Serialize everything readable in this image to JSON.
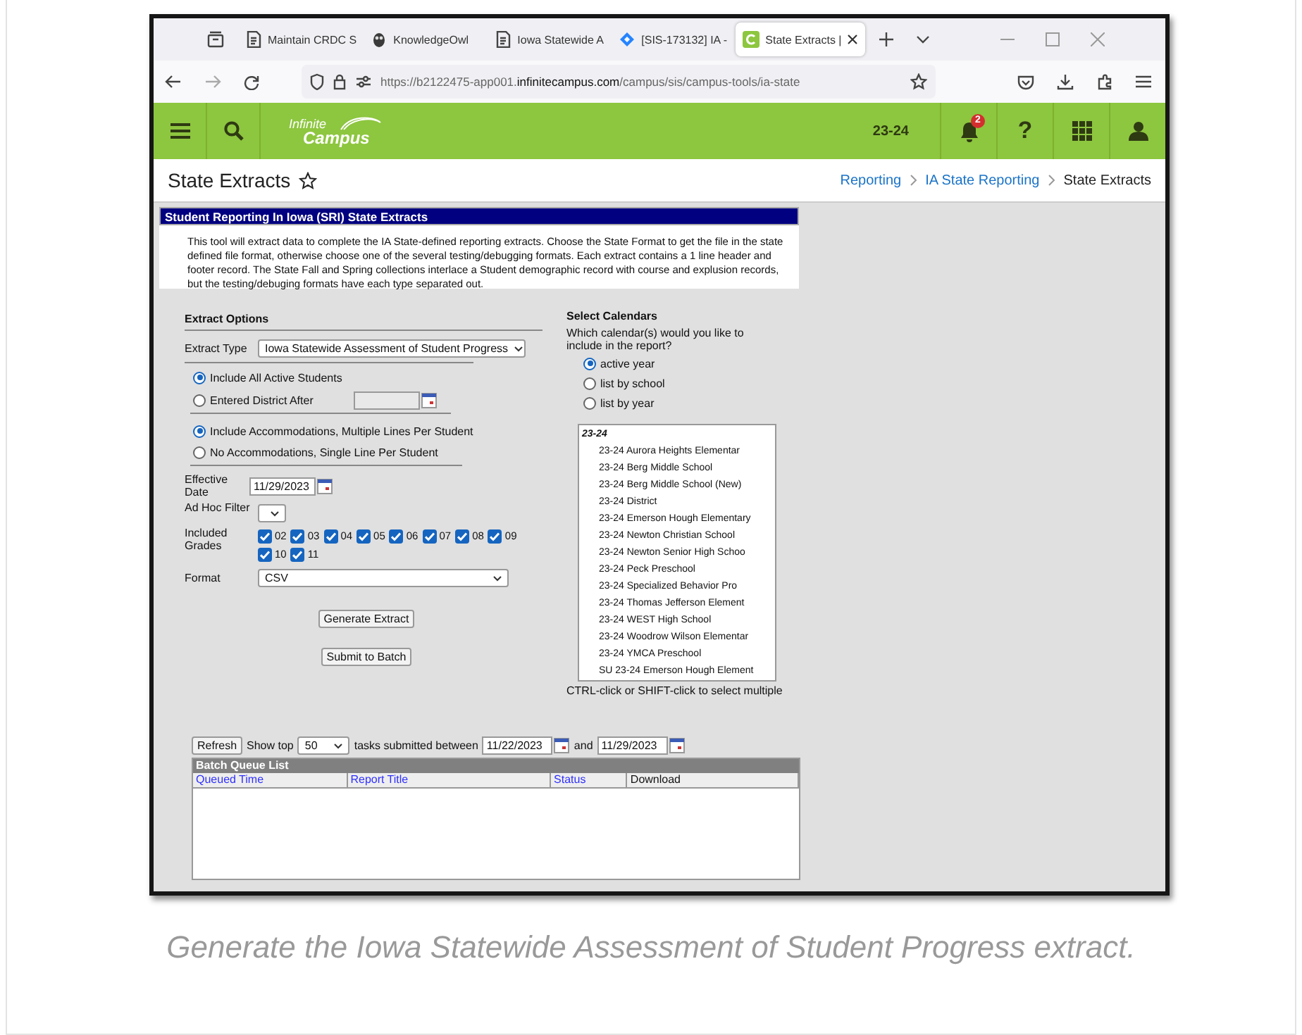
{
  "browser": {
    "tabs": [
      {
        "label": "Maintain CRDC S",
        "kind": "doc",
        "selected": false
      },
      {
        "label": "KnowledgeOwl",
        "kind": "owl",
        "selected": false
      },
      {
        "label": "Iowa Statewide A",
        "kind": "doc",
        "selected": false
      },
      {
        "label": "[SIS-173132] IA -",
        "kind": "jira",
        "selected": false
      },
      {
        "label": "State Extracts |",
        "kind": "app",
        "selected": true
      }
    ],
    "url": {
      "prefix": "https://b2122475-app001.",
      "domain": "infinitecampus.com",
      "path": "/campus/sis/campus-tools/ia-state"
    }
  },
  "app_header": {
    "logo": [
      "Infinite",
      "Campus"
    ],
    "school_year": "23-24",
    "notification_count": "2",
    "help": "?"
  },
  "page": {
    "title": "State Extracts",
    "breadcrumb": [
      "Reporting",
      "IA State Reporting",
      "State Extracts"
    ]
  },
  "panel": {
    "title": "Student Reporting In Iowa (SRI) State Extracts",
    "description": "This tool will extract data to complete the IA State-defined reporting extracts. Choose the State Format to get the file in the state defined file format, otherwise choose one of the several testing/debugging formats. Each extract contains a 1 line header and footer record. The State Fall and Spring collections interlace a Student demographic record with course and explusion records, but the testing/debuging formats have each type separated out."
  },
  "extract_options": {
    "heading": "Extract Options",
    "extract_type": {
      "label": "Extract Type",
      "value": "Iowa Statewide Assessment of Student Progress"
    },
    "student_options": [
      {
        "label": "Include All Active Students",
        "selected": true
      },
      {
        "label": "Entered District After",
        "selected": false
      }
    ],
    "accommodation_options": [
      {
        "label": "Include Accommodations, Multiple Lines Per Student",
        "selected": true
      },
      {
        "label": "No Accommodations, Single Line Per Student",
        "selected": false
      }
    ],
    "effective_date": {
      "label": "Effective Date",
      "value": "11/29/2023"
    },
    "ad_hoc_filter": {
      "label": "Ad Hoc Filter"
    },
    "included_grades": {
      "label": "Included Grades",
      "grades": [
        {
          "label": "02",
          "checked": true
        },
        {
          "label": "03",
          "checked": true
        },
        {
          "label": "04",
          "checked": true
        },
        {
          "label": "05",
          "checked": true
        },
        {
          "label": "06",
          "checked": true
        },
        {
          "label": "07",
          "checked": true
        },
        {
          "label": "08",
          "checked": true
        },
        {
          "label": "09",
          "checked": true
        },
        {
          "label": "10",
          "checked": true
        },
        {
          "label": "11",
          "checked": true
        }
      ]
    },
    "format": {
      "label": "Format",
      "value": "CSV"
    },
    "buttons": [
      "Generate Extract",
      "Submit to Batch"
    ]
  },
  "select_calendars": {
    "heading": "Select Calendars",
    "question": "Which calendar(s) would you like to include in the report?",
    "options": [
      {
        "label": "active year",
        "selected": true
      },
      {
        "label": "list by school",
        "selected": false
      },
      {
        "label": "list by year",
        "selected": false
      }
    ],
    "list": [
      {
        "label": "23-24",
        "children": [
          {
            "label": "23-24 Aurora Heights Elementar"
          },
          {
            "label": "23-24 Berg Middle School"
          },
          {
            "label": "23-24 Berg Middle School (New)"
          },
          {
            "label": "23-24 District"
          },
          {
            "label": "23-24 Emerson Hough Elementary"
          },
          {
            "label": "23-24 Newton Christian School"
          },
          {
            "label": "23-24 Newton Senior High Schoo"
          },
          {
            "label": "23-24 Peck Preschool"
          },
          {
            "label": "23-24 Specialized Behavior Pro"
          },
          {
            "label": "23-24 Thomas Jefferson Element"
          },
          {
            "label": "23-24 WEST High School"
          },
          {
            "label": "23-24 Woodrow Wilson Elementar"
          },
          {
            "label": "23-24 YMCA Preschool"
          },
          {
            "label": "SU 23-24 Emerson Hough Element"
          }
        ]
      }
    ],
    "hint": "CTRL-click or SHIFT-click to select multiple"
  },
  "batch": {
    "refresh": "Refresh",
    "show_top": "Show top",
    "count": "50",
    "between": "tasks submitted between",
    "from": "11/22/2023",
    "and": "and",
    "to": "11/29/2023",
    "title": "Batch Queue List",
    "columns": [
      {
        "label": "Queued Time",
        "kind": "link"
      },
      {
        "label": "Report Title",
        "kind": "link"
      },
      {
        "label": "Status",
        "kind": "link"
      },
      {
        "label": "Download",
        "kind": "plain"
      }
    ]
  },
  "caption": "Generate the Iowa Statewide Assessment of Student Progress extract."
}
